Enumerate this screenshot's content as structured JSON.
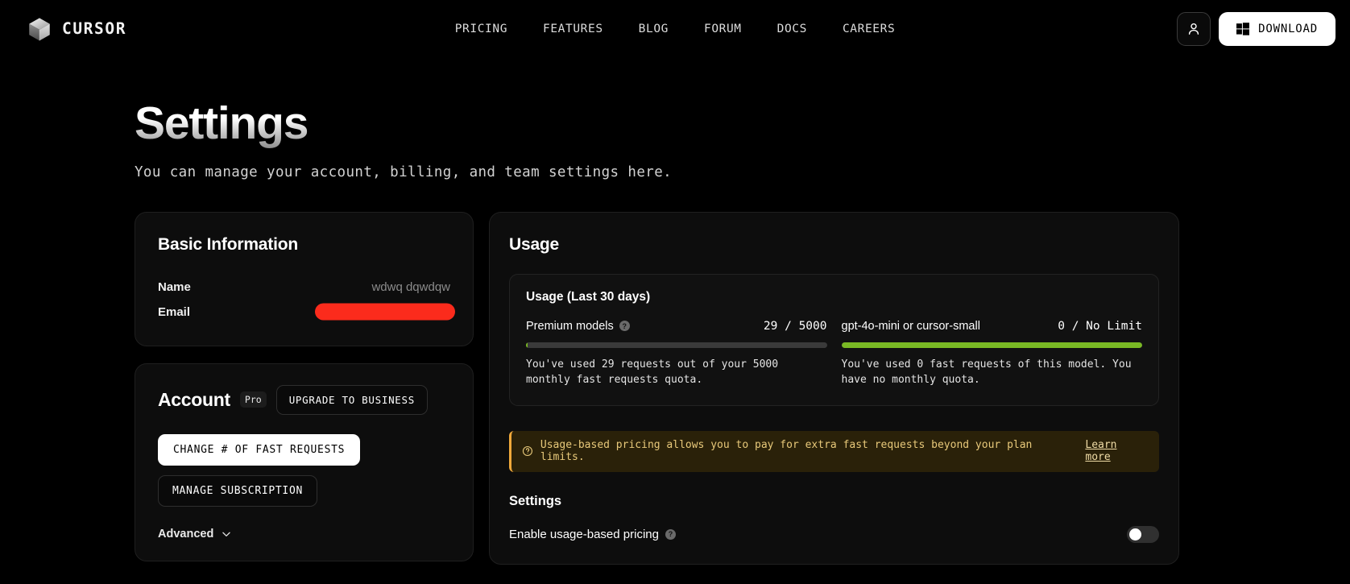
{
  "nav": {
    "brand": "CURSOR",
    "brand_icon": "cube-logo-icon",
    "links": [
      {
        "label": "PRICING"
      },
      {
        "label": "FEATURES"
      },
      {
        "label": "BLOG"
      },
      {
        "label": "FORUM"
      },
      {
        "label": "DOCS"
      },
      {
        "label": "CAREERS"
      }
    ],
    "account_icon": "user-icon",
    "download": {
      "label": "DOWNLOAD",
      "icon": "windows-icon"
    }
  },
  "page": {
    "title": "Settings",
    "subtitle": "You can manage your account, billing, and team settings here."
  },
  "basic_information": {
    "title": "Basic Information",
    "rows": [
      {
        "label": "Name",
        "value": "wdwq dqwdqw",
        "redacted": false
      },
      {
        "label": "Email",
        "value": "redacted-email-address",
        "redacted": true
      }
    ],
    "redaction_color": "#fb2b1c"
  },
  "account": {
    "title": "Account",
    "plan_badge": "Pro",
    "upgrade_label": "UPGRADE TO BUSINESS",
    "change_requests_label": "CHANGE # OF FAST REQUESTS",
    "manage_subscription_label": "MANAGE SUBSCRIPTION",
    "advanced_label": "Advanced",
    "advanced_icon": "chevron-down-icon"
  },
  "usage": {
    "title": "Usage",
    "section_title": "Usage (Last 30 days)",
    "help_icon": "question-mark-icon",
    "bar_color": "#79b824",
    "bar_track_color": "#3a3a3a",
    "meters": [
      {
        "name": "Premium models",
        "count": "29 / 5000",
        "used": 29,
        "limit": 5000,
        "percent": 0.58,
        "note": "You've used 29 requests out of your 5000 monthly fast requests quota."
      },
      {
        "name": "gpt-4o-mini or cursor-small",
        "count": "0 / No Limit",
        "used": 0,
        "limit": null,
        "percent": 100,
        "note": "You've used 0 fast requests of this model. You have no monthly quota."
      }
    ],
    "notice": {
      "icon": "info-circle-icon",
      "text": "Usage-based pricing allows you to pay for extra fast requests beyond your plan limits.",
      "link_label": "Learn more",
      "accent_color": "#f0a93b"
    },
    "settings": {
      "title": "Settings",
      "toggle_label": "Enable usage-based pricing",
      "toggle_help_icon": "question-mark-icon",
      "toggle_state": "off"
    }
  }
}
